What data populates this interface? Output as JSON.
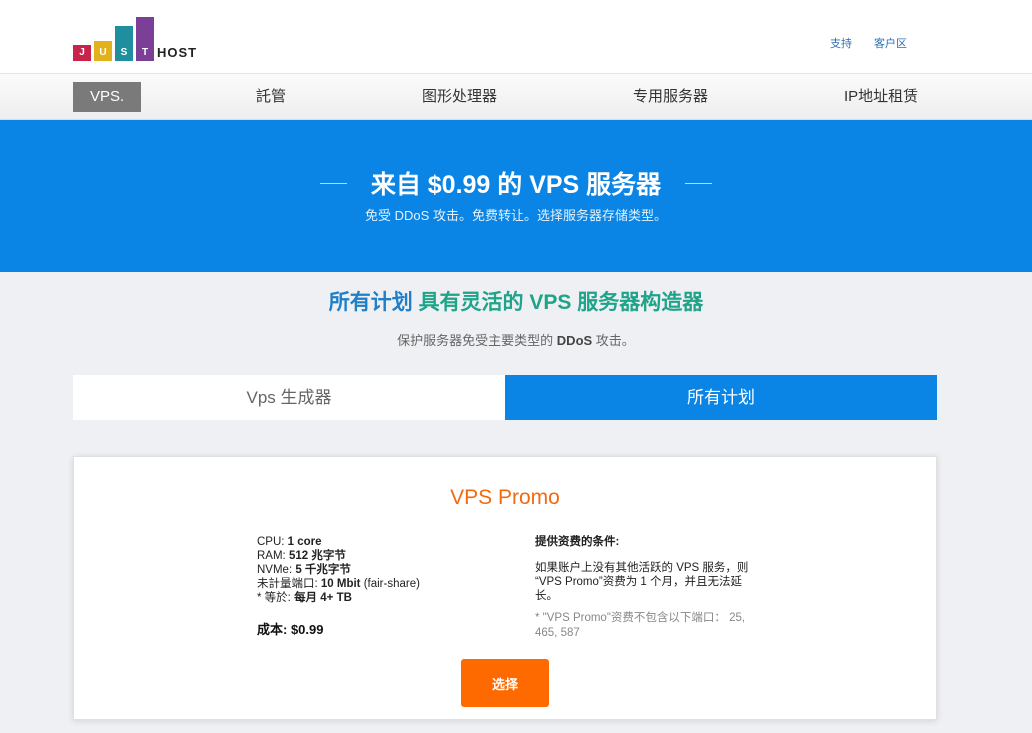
{
  "header": {
    "logo_letters": [
      "J",
      "U",
      "S",
      "T"
    ],
    "logo_host": "HOST",
    "links": {
      "support": "支持",
      "client_area": "客户区"
    }
  },
  "nav": {
    "items": [
      "VPS.",
      "託管",
      "图形处理器",
      "专用服务器",
      "IP地址租赁"
    ]
  },
  "hero": {
    "title": "来自 $0.99 的 VPS 服务器",
    "subtitle": "免受 DDoS 攻击。免费转让。选择服务器存储类型。"
  },
  "section": {
    "title_part1": "所有计划 ",
    "title_part2": "具有灵活的 VPS 服务器构造器",
    "subtitle_pre": "保护服务器免受主要类型的 ",
    "subtitle_bold": "DDoS",
    "subtitle_post": " 攻击。"
  },
  "tabs": {
    "builder": "Vps 生成器",
    "all_plans": "所有计划"
  },
  "plan": {
    "name": "VPS Promo",
    "specs": [
      {
        "label": "CPU: ",
        "value": "1 core",
        "suffix": ""
      },
      {
        "label": "RAM: ",
        "value": "512 兆字节",
        "suffix": ""
      },
      {
        "label": "NVMe: ",
        "value": "5 千兆字节",
        "suffix": ""
      },
      {
        "label": "未計量端口: ",
        "value": "10 Mbit",
        "suffix": " (fair-share)"
      },
      {
        "label": "* 等於: ",
        "value": "每月 4+ TB",
        "suffix": ""
      }
    ],
    "price": "成本: $0.99",
    "conditions_title": "提供资费的条件:",
    "conditions_text": "如果账户上没有其他活跃的 VPS 服务，则 “VPS Promo”资费为 1 个月，并且无法延长。",
    "conditions_note": "* \"VPS Promo\"资费不包含以下端口： 25, 465, 587",
    "select_label": "选择"
  },
  "colors": {
    "primary_blue": "#0a85e5",
    "accent_orange": "#ff6a00",
    "title_orange": "#f26a10",
    "heading_blue": "#1f7fc8",
    "heading_green": "#1fa389",
    "logo_bars": [
      "#c8234a",
      "#e2b21e",
      "#1f8e9e",
      "#7b3f98"
    ]
  }
}
